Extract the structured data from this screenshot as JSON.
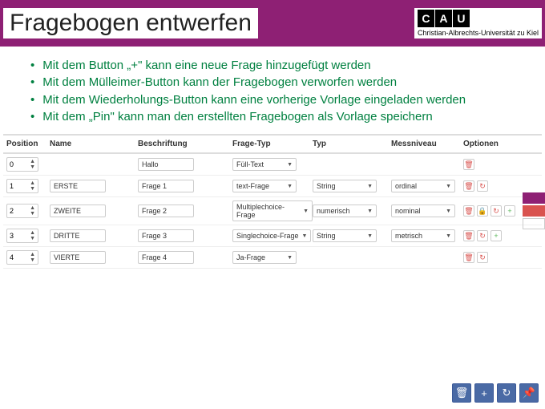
{
  "header": {
    "title": "Fragebogen entwerfen",
    "logo_c": "C",
    "logo_a": "A",
    "logo_u": "U",
    "logo_sub": "Christian-Albrechts-Universität zu Kiel"
  },
  "bullets": [
    "Mit dem Button „+\" kann eine neue Frage hinzugefügt werden",
    "Mit dem Mülleimer-Button kann der Fragebogen verworfen werden",
    "Mit dem Wiederholungs-Button kann eine vorherige Vorlage eingeladen werden",
    "Mit dem „Pin\" kann man den erstellten Fragebogen als Vorlage speichern"
  ],
  "table": {
    "headers": {
      "position": "Position",
      "name": "Name",
      "beschriftung": "Beschriftung",
      "fragetyp": "Frage-Typ",
      "typ": "Typ",
      "messniveau": "Messniveau",
      "optionen": "Optionen"
    },
    "rows": [
      {
        "pos": "0",
        "name": "",
        "besch": "Hallo",
        "ftyp": "Füll-Text",
        "typ": "",
        "mess": "",
        "opts": [
          "trash"
        ]
      },
      {
        "pos": "1",
        "name": "ERSTE",
        "besch": "Frage 1",
        "ftyp": "text-Frage",
        "typ": "String",
        "mess": "ordinal",
        "opts": [
          "trash",
          "refresh"
        ]
      },
      {
        "pos": "2",
        "name": "ZWEITE",
        "besch": "Frage 2",
        "ftyp": "Multiplechoice-Frage",
        "typ": "numerisch",
        "mess": "nominal",
        "opts": [
          "trash",
          "lock",
          "refresh",
          "plus"
        ]
      },
      {
        "pos": "3",
        "name": "DRITTE",
        "besch": "Frage 3",
        "ftyp": "Singlechoice-Frage",
        "typ": "String",
        "mess": "metrisch",
        "opts": [
          "trash",
          "refresh",
          "plus"
        ]
      },
      {
        "pos": "4",
        "name": "VIERTE",
        "besch": "Frage 4",
        "ftyp": "Ja-Frage",
        "typ": "",
        "mess": "",
        "opts": [
          "trash",
          "refresh"
        ]
      }
    ]
  },
  "icons": {
    "trash_glyph": "🗑",
    "refresh_glyph": "↻",
    "plus_glyph": "+",
    "lock_glyph": "🔒",
    "pin_glyph": "📌"
  }
}
